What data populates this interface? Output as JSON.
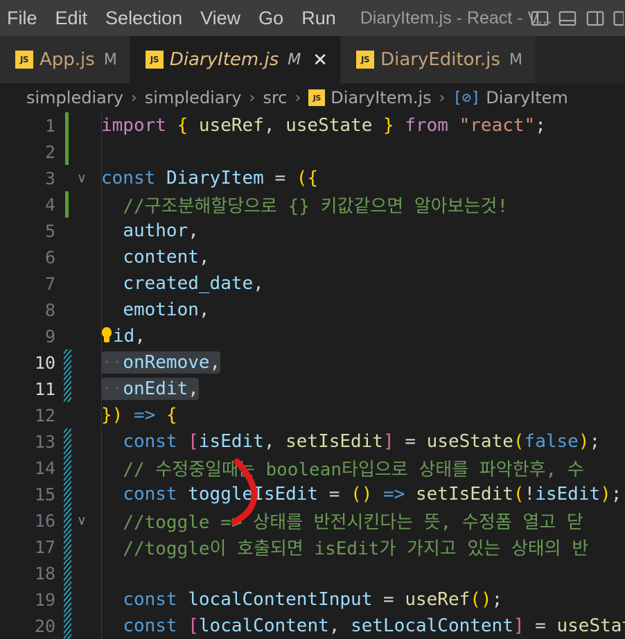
{
  "titlebar": {
    "menus": [
      {
        "label": "File",
        "name": "menu-file"
      },
      {
        "label": "Edit",
        "name": "menu-edit"
      },
      {
        "label": "Selection",
        "name": "menu-selection"
      },
      {
        "label": "View",
        "name": "menu-view"
      },
      {
        "label": "Go",
        "name": "menu-go"
      },
      {
        "label": "Run",
        "name": "menu-run"
      }
    ],
    "window_title": "DiaryItem.js - React - V...",
    "actions": [
      {
        "name": "toggle-primary-sidebar-icon",
        "tooltip": "Toggle Primary Side Bar"
      },
      {
        "name": "toggle-panel-icon",
        "tooltip": "Toggle Panel"
      },
      {
        "name": "toggle-secondary-sidebar-icon",
        "tooltip": "Toggle Secondary Side Bar"
      },
      {
        "name": "customize-layout-icon",
        "tooltip": "Customize Layout"
      }
    ]
  },
  "tabs": [
    {
      "label": "App.js",
      "badge": "JS",
      "dirty": "M",
      "active": false,
      "closable": false
    },
    {
      "label": "DiaryItem.js",
      "badge": "JS",
      "dirty": "M",
      "active": true,
      "closable": true,
      "close": "✕"
    },
    {
      "label": "DiaryEditor.js",
      "badge": "JS",
      "dirty": "M",
      "active": false,
      "closable": false
    }
  ],
  "breadcrumb": {
    "separator": "›",
    "items": [
      {
        "label": "simplediary",
        "icon": null
      },
      {
        "label": "simplediary",
        "icon": null
      },
      {
        "label": "src",
        "icon": null
      },
      {
        "label": "DiaryItem.js",
        "icon": "js-file-icon",
        "icon_text": "JS"
      },
      {
        "label": "DiaryItem",
        "icon": "symbol-variable-icon",
        "icon_text": "[⊘]"
      }
    ]
  },
  "editor": {
    "language": "javascript",
    "colors": {
      "background": "#1e1e1e",
      "keyword": "#c586c0",
      "const": "#569cd6",
      "variable": "#9cdcfe",
      "function": "#dcdcaa",
      "string": "#ce9178",
      "comment": "#6a9955",
      "brace": "#ffd700",
      "bracket": "#e06c9f",
      "selection": "#3a3d41",
      "change_bar": "#5a9e2f",
      "gutter_hatch": "#2e9bb5",
      "annotation": "#e01b1b"
    },
    "annotation": {
      "name": "red-closing-paren-annotation",
      "shape": "hand-drawn closing parenthesis",
      "color": "#e01b1b"
    },
    "lines": [
      {
        "n": "1",
        "change": "green",
        "fold": "",
        "current": false,
        "raw": "import { useRef, useState } from \"react\";"
      },
      {
        "n": "2",
        "change": "green",
        "fold": "",
        "current": false,
        "raw": ""
      },
      {
        "n": "3",
        "change": "",
        "fold": "∨",
        "current": false,
        "raw": "const DiaryItem = ({"
      },
      {
        "n": "4",
        "change": "green",
        "fold": "",
        "current": false,
        "raw": "  //구조분해할당으로 {} 키값같으면 알아보는것!"
      },
      {
        "n": "5",
        "change": "",
        "fold": "",
        "current": false,
        "raw": "  author,"
      },
      {
        "n": "6",
        "change": "",
        "fold": "",
        "current": false,
        "raw": "  content,"
      },
      {
        "n": "7",
        "change": "",
        "fold": "",
        "current": false,
        "raw": "  created_date,"
      },
      {
        "n": "8",
        "change": "",
        "fold": "",
        "current": false,
        "raw": "  emotion,"
      },
      {
        "n": "9",
        "change": "",
        "fold": "",
        "current": false,
        "raw": "  id,",
        "lightbulb": true
      },
      {
        "n": "10",
        "change": "hatch",
        "fold": "",
        "current": true,
        "raw": "  onRemove,",
        "selected": true
      },
      {
        "n": "11",
        "change": "hatch",
        "fold": "",
        "current": true,
        "raw": "  onEdit,",
        "selected": true
      },
      {
        "n": "12",
        "change": "",
        "fold": "",
        "current": false,
        "raw": "}) => {"
      },
      {
        "n": "13",
        "change": "hatch",
        "fold": "",
        "current": false,
        "raw": "  const [isEdit, setIsEdit] = useState(false);"
      },
      {
        "n": "14",
        "change": "hatch",
        "fold": "",
        "current": false,
        "raw": "  // 수정중일때는 boolean타입으로 상태를 파악한후, 수"
      },
      {
        "n": "15",
        "change": "hatch",
        "fold": "",
        "current": false,
        "raw": "  const toggleIsEdit = () => setIsEdit(!isEdit);"
      },
      {
        "n": "16",
        "change": "hatch",
        "fold": "∨",
        "current": false,
        "raw": "  //toggle => 상태를 반전시킨다는 뜻, 수정폼 열고 닫"
      },
      {
        "n": "17",
        "change": "hatch",
        "fold": "",
        "current": false,
        "raw": "  //toggle이 호출되면 isEdit가 가지고 있는 상태의 반"
      },
      {
        "n": "18",
        "change": "hatch",
        "fold": "",
        "current": false,
        "raw": ""
      },
      {
        "n": "19",
        "change": "hatch",
        "fold": "",
        "current": false,
        "raw": "  const localContentInput = useRef();"
      },
      {
        "n": "20",
        "change": "hatch",
        "fold": "",
        "current": false,
        "raw": "  const [localContent, setLocalContent] = useStat"
      }
    ]
  }
}
